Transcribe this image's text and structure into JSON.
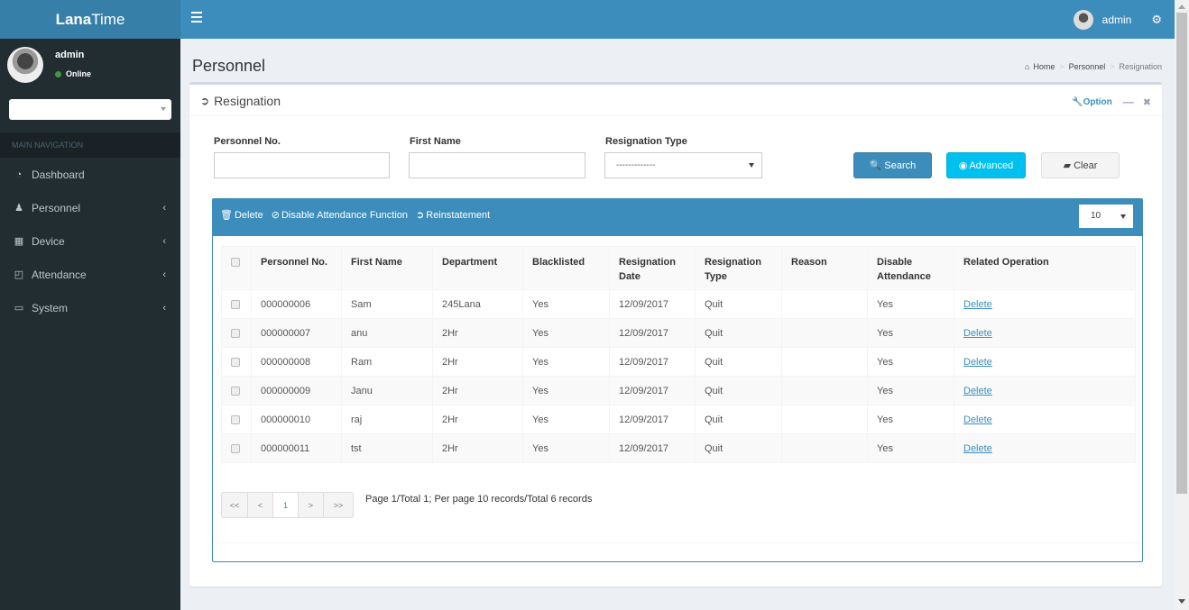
{
  "app": {
    "logo_bold": "Lana",
    "logo_rest": "Time"
  },
  "topbar": {
    "username": "admin",
    "settings_icon": "gears-icon"
  },
  "sidebar": {
    "user": {
      "name": "admin",
      "status": "Online"
    },
    "nav_header": "MAIN NAVIGATION",
    "items": [
      {
        "label": "Dashboard",
        "icon": "dashboard-icon",
        "glyph": "◔",
        "has_children": false
      },
      {
        "label": "Personnel",
        "icon": "users-icon",
        "glyph": "👥",
        "has_children": true
      },
      {
        "label": "Device",
        "icon": "building-icon",
        "glyph": "▦",
        "has_children": true
      },
      {
        "label": "Attendance",
        "icon": "sticky-note-icon",
        "glyph": "◰",
        "has_children": true
      },
      {
        "label": "System",
        "icon": "laptop-icon",
        "glyph": "⌨",
        "has_children": true
      }
    ],
    "chevron": "‹"
  },
  "page": {
    "title": "Personnel",
    "breadcrumb": {
      "home": "Home",
      "items": [
        "Personnel"
      ],
      "active": "Resignation",
      "sep": ">"
    }
  },
  "box": {
    "title": "Resignation",
    "option_label": "Option",
    "minus": "—",
    "close": "✖"
  },
  "filters": {
    "personnel_no": {
      "label": "Personnel No.",
      "value": ""
    },
    "first_name": {
      "label": "First Name",
      "value": ""
    },
    "resignation_type": {
      "label": "Resignation Type",
      "value": "-------------"
    },
    "search_label": "Search",
    "advanced_label": "Advanced",
    "clear_label": "Clear"
  },
  "toolbar": {
    "delete_label": "Delete",
    "disable_label": "Disable Attendance Function",
    "reinstate_label": "Reinstatement",
    "page_size": "10"
  },
  "table": {
    "headers": [
      "Personnel No.",
      "First Name",
      "Department",
      "Blacklisted",
      "Resignation Date",
      "Resignation Type",
      "Reason",
      "Disable Attendance",
      "Related Operation"
    ],
    "rows": [
      {
        "no": "000000006",
        "first": "Sam",
        "dept": "245Lana",
        "black": "Yes",
        "date": "12/09/2017",
        "type": "Quit",
        "reason": "",
        "disable": "Yes",
        "op": "Delete"
      },
      {
        "no": "000000007",
        "first": "anu",
        "dept": "2Hr",
        "black": "Yes",
        "date": "12/09/2017",
        "type": "Quit",
        "reason": "",
        "disable": "Yes",
        "op": "Delete"
      },
      {
        "no": "000000008",
        "first": "Ram",
        "dept": "2Hr",
        "black": "Yes",
        "date": "12/09/2017",
        "type": "Quit",
        "reason": "",
        "disable": "Yes",
        "op": "Delete"
      },
      {
        "no": "000000009",
        "first": "Janu",
        "dept": "2Hr",
        "black": "Yes",
        "date": "12/09/2017",
        "type": "Quit",
        "reason": "",
        "disable": "Yes",
        "op": "Delete"
      },
      {
        "no": "000000010",
        "first": "raj",
        "dept": "2Hr",
        "black": "Yes",
        "date": "12/09/2017",
        "type": "Quit",
        "reason": "",
        "disable": "Yes",
        "op": "Delete"
      },
      {
        "no": "000000011",
        "first": "tst",
        "dept": "2Hr",
        "black": "Yes",
        "date": "12/09/2017",
        "type": "Quit",
        "reason": "",
        "disable": "Yes",
        "op": "Delete"
      }
    ]
  },
  "pagination": {
    "first": "<<",
    "prev": "<",
    "current": "1",
    "next": ">",
    "last": ">>",
    "info": "Page 1/Total 1; Per page 10 records/Total 6 records"
  },
  "colors": {
    "primary": "#3c8dbc",
    "info": "#00c0ef",
    "sidebar": "#222d32",
    "online": "#3c9a3c"
  }
}
